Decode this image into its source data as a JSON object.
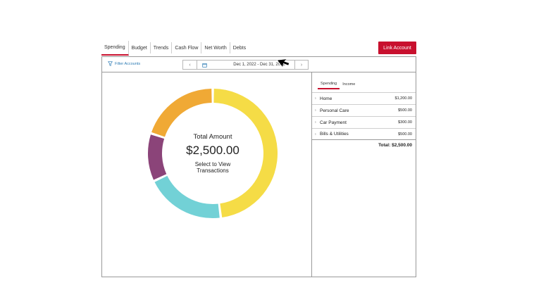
{
  "tabs": [
    {
      "label": "Spending",
      "active": true
    },
    {
      "label": "Budget"
    },
    {
      "label": "Trends"
    },
    {
      "label": "Cash Flow"
    },
    {
      "label": "Net Worth"
    },
    {
      "label": "Debts"
    }
  ],
  "link_account_label": "Link Account",
  "toolbar": {
    "filter_label": "Filter Accounts",
    "date_range": "Dec 1, 2022 - Dec 31, 2022",
    "prev_icon": "chevron-left-icon",
    "next_icon": "chevron-right-icon",
    "calendar_icon": "calendar-icon",
    "filter_icon": "funnel-icon"
  },
  "donut": {
    "title": "Total Amount",
    "amount": "$2,500.00",
    "hint": "Select to View Transactions"
  },
  "side_tabs": [
    {
      "label": "Spending",
      "active": true
    },
    {
      "label": "Income"
    }
  ],
  "categories": [
    {
      "name": "Home",
      "amount": "$1,200.00",
      "value": 1200,
      "color": "#f5dc46"
    },
    {
      "name": "Personal Care",
      "amount": "$500.00",
      "value": 500,
      "color": "#72d1d6"
    },
    {
      "name": "Car Payment",
      "amount": "$300.00",
      "value": 300,
      "color": "#8b4479"
    },
    {
      "name": "Bills & Utilities",
      "amount": "$500.00",
      "value": 500,
      "color": "#f0a935"
    }
  ],
  "total_label": "Total: $2,500.00",
  "colors": {
    "accent": "#c8102e",
    "link": "#2b7ab3"
  }
}
